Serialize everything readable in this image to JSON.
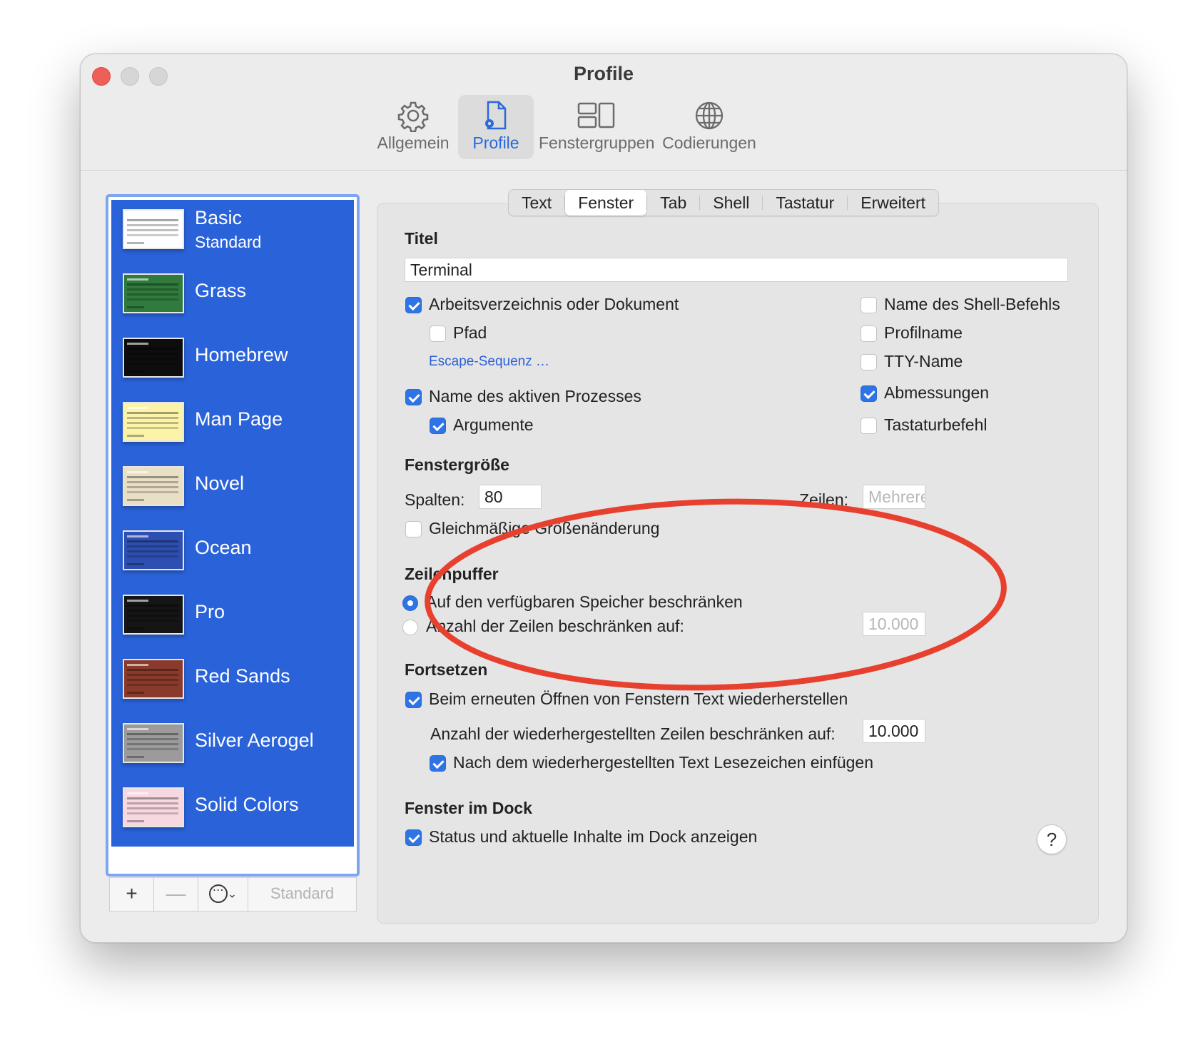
{
  "window": {
    "title": "Profile"
  },
  "toolbar": {
    "items": [
      {
        "label": "Allgemein",
        "icon": "gear-icon"
      },
      {
        "label": "Profile",
        "icon": "profile-document-icon"
      },
      {
        "label": "Fenstergruppen",
        "icon": "window-groups-icon"
      },
      {
        "label": "Codierungen",
        "icon": "globe-icon"
      }
    ],
    "active": "Profile"
  },
  "sidebar": {
    "profiles": [
      {
        "name": "Basic",
        "sub": "Standard",
        "theme": "#ffffff"
      },
      {
        "name": "Grass",
        "sub": "",
        "theme": "#2f7a3c"
      },
      {
        "name": "Homebrew",
        "sub": "",
        "theme": "#0d0d0d"
      },
      {
        "name": "Man Page",
        "sub": "",
        "theme": "#fbf3a8"
      },
      {
        "name": "Novel",
        "sub": "",
        "theme": "#e9dfc4"
      },
      {
        "name": "Ocean",
        "sub": "",
        "theme": "#2e4fb2"
      },
      {
        "name": "Pro",
        "sub": "",
        "theme": "#151515"
      },
      {
        "name": "Red Sands",
        "sub": "",
        "theme": "#8a3a2a"
      },
      {
        "name": "Silver Aerogel",
        "sub": "",
        "theme": "#9b9b9b"
      },
      {
        "name": "Solid Colors",
        "sub": "",
        "theme": "#f7d8e1"
      }
    ],
    "bottom": {
      "add": "+",
      "remove": "—",
      "more": "⋯",
      "default_label": "Standard"
    }
  },
  "tabs": [
    "Text",
    "Fenster",
    "Tab",
    "Shell",
    "Tastatur",
    "Erweitert"
  ],
  "active_tab": "Fenster",
  "titel": {
    "heading": "Titel",
    "value": "Terminal",
    "options_left": {
      "arbeitsverzeichnis": "Arbeitsverzeichnis oder Dokument",
      "pfad": "Pfad",
      "escape": "Escape-Sequenz …",
      "prozess": "Name des aktiven Prozesses",
      "argumente": "Argumente"
    },
    "options_right": {
      "shell_befehl": "Name des Shell-Befehls",
      "profilname": "Profilname",
      "tty": "TTY-Name",
      "abmessungen": "Abmessungen",
      "tastaturbefehl": "Tastaturbefehl"
    }
  },
  "fenstergroesse": {
    "heading": "Fenstergröße",
    "spalten_label": "Spalten:",
    "spalten_value": "80",
    "zeilen_label": "Zeilen:",
    "zeilen_placeholder": "Mehrere",
    "gleichmaessig": "Gleichmäßige Größenänderung"
  },
  "zeilenpuffer": {
    "heading": "Zeilenpuffer",
    "option_speicher": "Auf den verfügbaren Speicher beschränken",
    "option_zeilen": "Anzahl der Zeilen beschränken auf:",
    "zeilen_value": "10.000"
  },
  "fortsetzen": {
    "heading": "Fortsetzen",
    "wiederherstellen": "Beim erneuten Öffnen von Fenstern Text wiederherstellen",
    "anzahl_label": "Anzahl der wiederhergestellten Zeilen beschränken auf:",
    "anzahl_value": "10.000",
    "lesezeichen": "Nach dem wiederhergestellten Text Lesezeichen einfügen"
  },
  "dock": {
    "heading": "Fenster im Dock",
    "status": "Status und aktuelle Inhalte im Dock anzeigen"
  },
  "help": "?",
  "colors": {
    "accent": "#2f74e6",
    "sidebar_selection": "#2a62da",
    "annotation": "#e8402e"
  }
}
